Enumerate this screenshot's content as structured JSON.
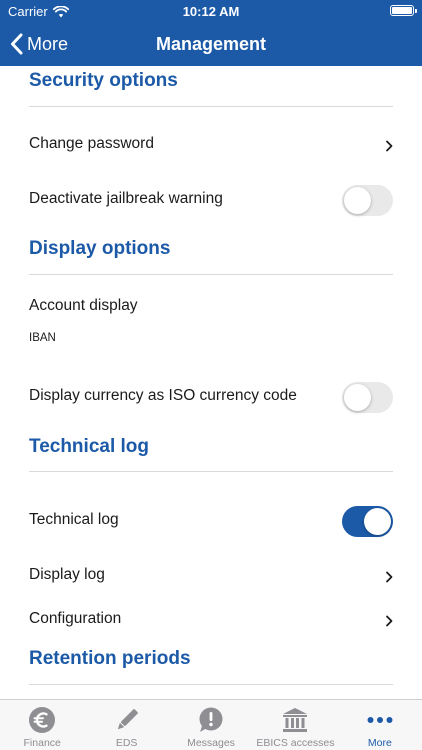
{
  "status_bar": {
    "carrier": "Carrier",
    "time": "10:12 AM"
  },
  "nav": {
    "back_label": "More",
    "title": "Management"
  },
  "sections": {
    "security": {
      "title": "Security options",
      "change_password": "Change password",
      "jailbreak_warning": {
        "label": "Deactivate jailbreak warning",
        "enabled": false
      }
    },
    "display": {
      "title": "Display options",
      "account_display": {
        "label": "Account display",
        "value": "IBAN"
      },
      "iso_currency": {
        "label": "Display currency as ISO currency code",
        "enabled": false
      }
    },
    "technical_log": {
      "title": "Technical log",
      "technical_log_toggle": {
        "label": "Technical log",
        "enabled": true
      },
      "display_log": "Display log",
      "configuration": "Configuration"
    },
    "retention": {
      "title": "Retention periods"
    }
  },
  "tabs": [
    {
      "label": "Finance",
      "icon": "euro-icon",
      "active": false
    },
    {
      "label": "EDS",
      "icon": "pencil-icon",
      "active": false
    },
    {
      "label": "Messages",
      "icon": "exclamation-bubble-icon",
      "active": false
    },
    {
      "label": "EBICS accesses",
      "icon": "bank-icon",
      "active": false
    },
    {
      "label": "More",
      "icon": "more-dots-icon",
      "active": true
    }
  ],
  "colors": {
    "brand": "#1c5aa8",
    "toggle_off": "#e9e9ea",
    "tab_inactive": "#8e8e93"
  }
}
